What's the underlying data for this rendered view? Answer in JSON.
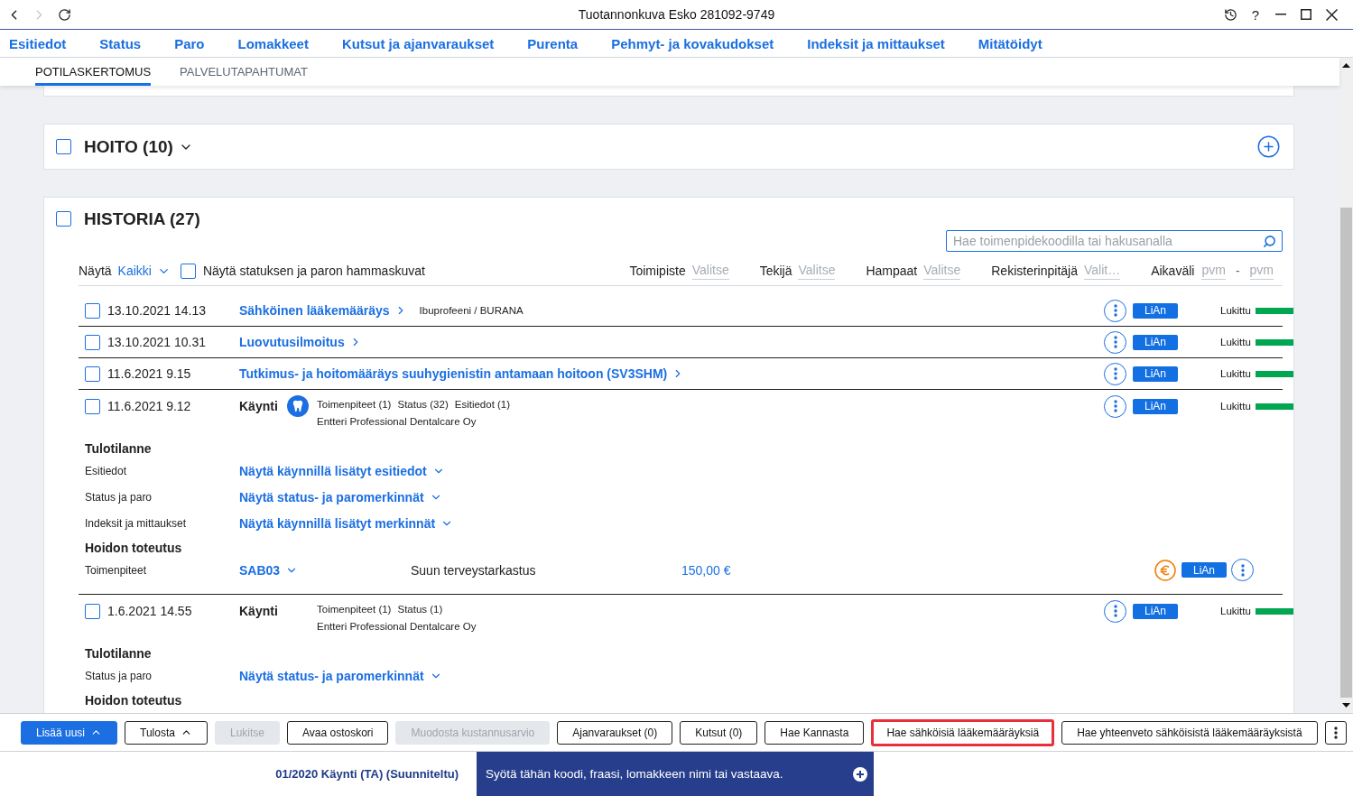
{
  "window": {
    "title": "Tuotannonkuva Esko 281092-9749",
    "help": "?",
    "back_disabled": false,
    "forward_disabled": true
  },
  "main_tabs": [
    {
      "label": "Esitiedot",
      "selected": false
    },
    {
      "label": "Status",
      "selected": false
    },
    {
      "label": "Paro",
      "selected": false
    },
    {
      "label": "Lomakkeet",
      "selected": false
    },
    {
      "label": "Kutsut ja ajanvaraukset",
      "selected": false
    },
    {
      "label": "Purenta",
      "selected": false
    },
    {
      "label": "Pehmyt- ja kovakudokset",
      "selected": false
    },
    {
      "label": "Indeksit ja mittaukset",
      "selected": false
    },
    {
      "label": "Mitätöidyt",
      "selected": false
    }
  ],
  "sub_tabs": [
    {
      "label": "POTILASKERTOMUS",
      "selected": true
    },
    {
      "label": "PALVELUTAPAHTUMAT",
      "selected": false
    }
  ],
  "care_section": {
    "title": "HOITO (10)",
    "checked": false
  },
  "history_section": {
    "title": "HISTORIA (27)",
    "checked": false,
    "search": {
      "placeholder": "Hae toimenpidekoodilla tai hakusanalla"
    },
    "filters": {
      "show": {
        "label": "Näytä",
        "value": "Kaikki"
      },
      "tooth_images": {
        "label": "Näytä statuksen ja paron hammaskuvat",
        "checked": false
      },
      "pickers": [
        {
          "label": "Toimipiste",
          "placeholder": "Valitse"
        },
        {
          "label": "Tekijä",
          "placeholder": "Valitse"
        },
        {
          "label": "Hampaat",
          "placeholder": "Valitse"
        },
        {
          "label": "Rekisterinpitäjä",
          "placeholder": "Valit…"
        }
      ],
      "date_range": {
        "label": "Aikaväli",
        "from_placeholder": "pvm",
        "separator": "-",
        "to_placeholder": "pvm"
      }
    },
    "entries": [
      {
        "kind": "document",
        "checked": false,
        "date": "13.10.2021 14.13",
        "title": "Sähköinen lääkemääräys",
        "note": "Ibuprofeeni / BURANA",
        "badge": "LiAn",
        "status": "Lukittu",
        "color": "#00a650"
      },
      {
        "kind": "document",
        "checked": false,
        "date": "13.10.2021 10.31",
        "title": "Luovutusilmoitus",
        "badge": "LiAn",
        "status": "Lukittu",
        "color": "#00a650"
      },
      {
        "kind": "document",
        "checked": false,
        "date": "11.6.2021 9.15",
        "title": "Tutkimus- ja hoitomääräys suuhygienistin antamaan hoitoon (SV3SHM)",
        "badge": "LiAn",
        "status": "Lukittu",
        "color": "#00a650"
      },
      {
        "kind": "visit",
        "checked": false,
        "date": "11.6.2021 9.12",
        "title": "Käynti",
        "tooth_icon": true,
        "summary": [
          "Toimenpiteet (1)",
          "Status (32)",
          "Esitiedot (1)"
        ],
        "provider": "Entteri Professional Dentalcare Oy",
        "badge": "LiAn",
        "status": "Lukittu",
        "color": "#00a650",
        "details": [
          {
            "kind": "heading",
            "text": "Tulotilanne"
          },
          {
            "kind": "link",
            "label": "Esitiedot",
            "link": "Näytä käynnillä lisätyt esitiedot"
          },
          {
            "kind": "link",
            "label": "Status ja paro",
            "link": "Näytä status- ja paromerkinnät"
          },
          {
            "kind": "link",
            "label": "Indeksit ja mittaukset",
            "link": "Näytä käynnillä lisätyt merkinnät"
          },
          {
            "kind": "heading",
            "text": "Hoidon toteutus"
          },
          {
            "kind": "procedure",
            "label": "Toimenpiteet",
            "code": "SAB03",
            "name": "Suun terveystarkastus",
            "price": "150,00 €",
            "badge": "LiAn"
          }
        ]
      },
      {
        "kind": "visit",
        "checked": false,
        "date": "1.6.2021 14.55",
        "title": "Käynti",
        "tooth_icon": false,
        "summary": [
          "Toimenpiteet (1)",
          "Status (1)"
        ],
        "provider": "Entteri Professional Dentalcare Oy",
        "badge": "LiAn",
        "status": "Lukittu",
        "color": "#00a650",
        "details": [
          {
            "kind": "heading",
            "text": "Tulotilanne"
          },
          {
            "kind": "link",
            "label": "Status ja paro",
            "link": "Näytä status- ja paromerkinnät"
          },
          {
            "kind": "heading",
            "text": "Hoidon toteutus"
          }
        ]
      }
    ]
  },
  "toolbar": {
    "buttons": [
      {
        "label": "Lisää uusi",
        "kind": "primary",
        "dropdown": true,
        "disabled": false,
        "highlighted": false
      },
      {
        "label": "Tulosta",
        "kind": "outline",
        "dropdown": true,
        "disabled": false,
        "highlighted": false
      },
      {
        "label": "Lukitse",
        "kind": "outline",
        "dropdown": false,
        "disabled": true,
        "highlighted": false
      },
      {
        "label": "Avaa ostoskori",
        "kind": "outline",
        "dropdown": false,
        "disabled": false,
        "highlighted": false
      },
      {
        "label": "Muodosta kustannusarvio",
        "kind": "outline",
        "dropdown": false,
        "disabled": true,
        "highlighted": false
      },
      {
        "label": "Ajanvaraukset (0)",
        "kind": "outline",
        "dropdown": false,
        "disabled": false,
        "highlighted": false
      },
      {
        "label": "Kutsut (0)",
        "kind": "outline",
        "dropdown": false,
        "disabled": false,
        "highlighted": false
      },
      {
        "label": "Hae Kannasta",
        "kind": "outline",
        "dropdown": false,
        "disabled": false,
        "highlighted": false
      },
      {
        "label": "Hae sähköisiä lääkemääräyksiä",
        "kind": "outline",
        "dropdown": false,
        "disabled": false,
        "highlighted": true
      },
      {
        "label": "Hae yhteenveto sähköisistä lääkemääräyksistä",
        "kind": "outline",
        "dropdown": false,
        "disabled": false,
        "highlighted": false
      }
    ]
  },
  "status_bar": {
    "context": "01/2020 Käynti (TA) (Suunniteltu)",
    "command": {
      "placeholder": "Syötä tähän koodi, fraasi, lomakkeen nimi tai vastaava."
    }
  }
}
